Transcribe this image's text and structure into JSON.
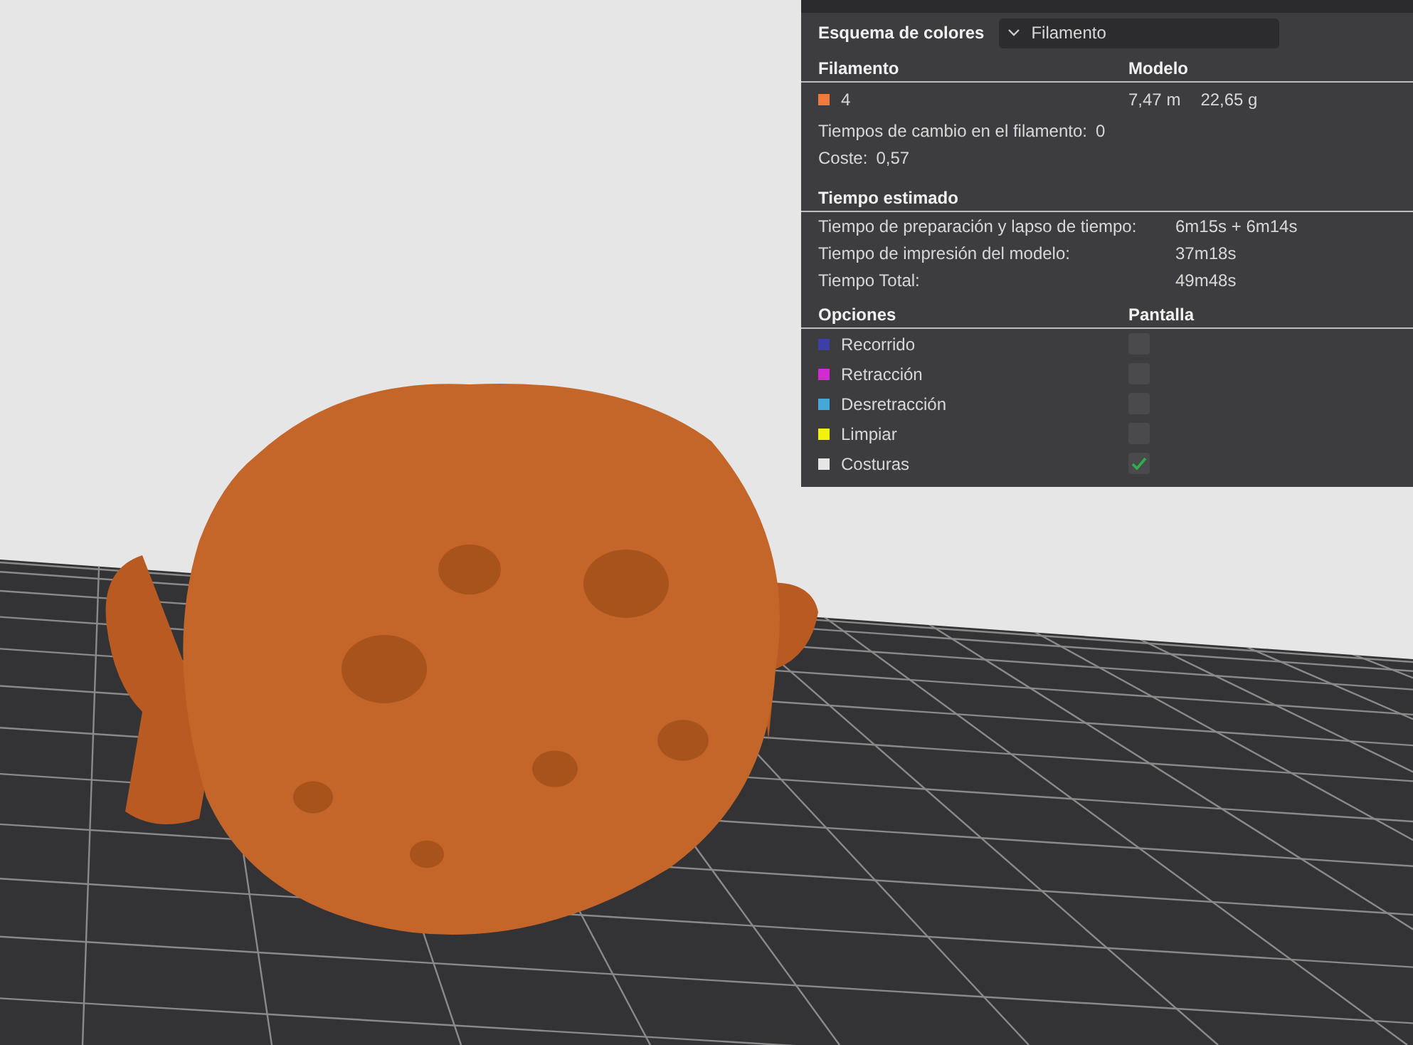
{
  "color_scheme": {
    "label": "Esquema de colores",
    "value": "Filamento"
  },
  "filament": {
    "columns": [
      "Filamento",
      "Modelo"
    ],
    "rows": [
      {
        "color": "#f07a3c",
        "name": "4",
        "length": "7,47 m",
        "weight": "22,65 g"
      }
    ],
    "change_times": {
      "label": "Tiempos de cambio en el filamento:",
      "value": "0"
    },
    "cost": {
      "label": "Coste:",
      "value": "0,57"
    }
  },
  "time": {
    "title": "Tiempo estimado",
    "rows": [
      {
        "label": "Tiempo de preparación y lapso de tiempo:",
        "value": "6m15s + 6m14s"
      },
      {
        "label": "Tiempo de impresión del modelo:",
        "value": "37m18s"
      },
      {
        "label": "Tiempo Total:",
        "value": "49m48s"
      }
    ]
  },
  "options": {
    "columns": [
      "Opciones",
      "Pantalla"
    ],
    "rows": [
      {
        "label": "Recorrido",
        "color": "#3b3fa6",
        "checked": false
      },
      {
        "label": "Retracción",
        "color": "#d42ad4",
        "checked": false
      },
      {
        "label": "Desretracción",
        "color": "#46a8d6",
        "checked": false
      },
      {
        "label": "Limpiar",
        "color": "#f2f20a",
        "checked": false
      },
      {
        "label": "Costuras",
        "color": "#e6e6e6",
        "checked": true
      }
    ]
  }
}
